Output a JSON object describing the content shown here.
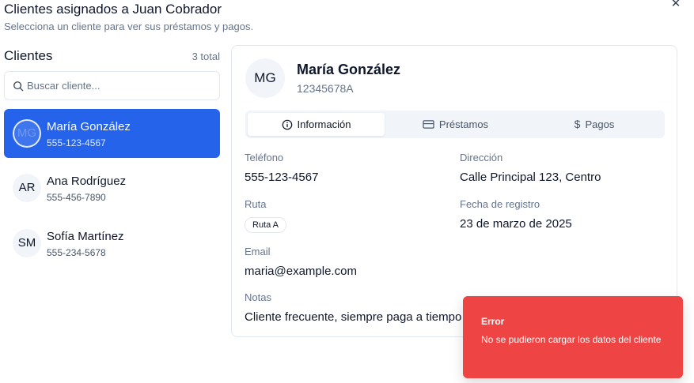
{
  "dialog": {
    "title": "Clientes asignados a Juan Cobrador",
    "subtitle": "Selecciona un cliente para ver sus préstamos y pagos.",
    "close_icon": "close-icon"
  },
  "clients_panel": {
    "heading": "Clientes",
    "count": "3 total",
    "search": {
      "placeholder": "Buscar cliente...",
      "value": ""
    },
    "items": [
      {
        "initials": "MG",
        "name": "María González",
        "phone": "555-123-4567",
        "selected": true
      },
      {
        "initials": "AR",
        "name": "Ana Rodríguez",
        "phone": "555-456-7890",
        "selected": false
      },
      {
        "initials": "SM",
        "name": "Sofía Martínez",
        "phone": "555-234-5678",
        "selected": false
      }
    ]
  },
  "detail": {
    "initials": "MG",
    "name": "María González",
    "id": "12345678A",
    "tabs": [
      {
        "label": "Información",
        "icon": "info-icon",
        "active": true
      },
      {
        "label": "Préstamos",
        "icon": "credit-card-icon",
        "active": false
      },
      {
        "label": "Pagos",
        "icon": "dollar-icon",
        "active": false
      }
    ],
    "fields": {
      "phone_label": "Teléfono",
      "phone_value": "555-123-4567",
      "address_label": "Dirección",
      "address_value": "Calle Principal 123, Centro",
      "route_label": "Ruta",
      "route_value": "Ruta A",
      "registered_label": "Fecha de registro",
      "registered_value": "23 de marzo de 2025",
      "email_label": "Email",
      "email_value": "maria@example.com",
      "notes_label": "Notas",
      "notes_value": "Cliente frecuente, siempre paga a tiempo"
    }
  },
  "toast": {
    "title": "Error",
    "message": "No se pudieron cargar los datos del cliente",
    "color": "#ef4444"
  },
  "colors": {
    "accent": "#2563eb",
    "muted_text": "#64748b",
    "border": "#e2e8f0"
  }
}
